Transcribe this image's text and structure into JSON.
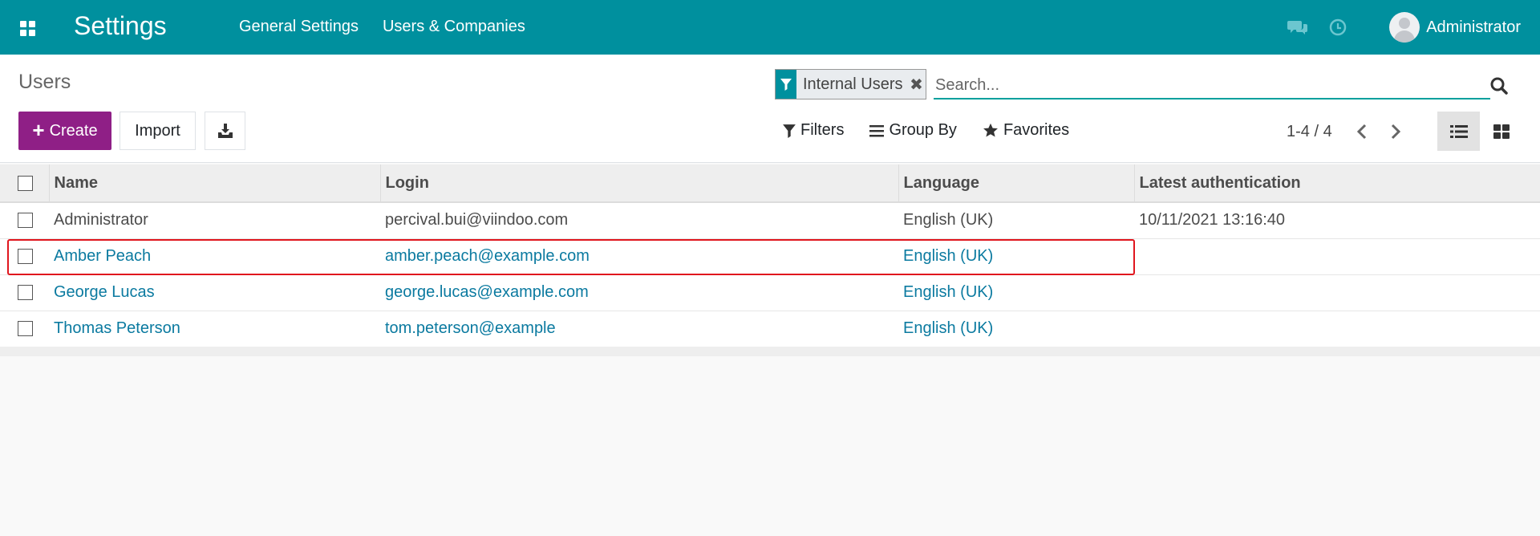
{
  "navbar": {
    "app_title": "Settings",
    "menu": [
      {
        "label": "General Settings"
      },
      {
        "label": "Users & Companies"
      }
    ],
    "user_name": "Administrator",
    "icons": [
      "apps-icon",
      "chat-icon",
      "clock-icon",
      "avatar"
    ],
    "color": "#00909e"
  },
  "control_panel": {
    "breadcrumb": "Users",
    "facet": {
      "label": "Internal Users",
      "icon": "filter-icon"
    },
    "search": {
      "placeholder": "Search..."
    },
    "buttons": {
      "create": "Create",
      "import": "Import"
    },
    "search_options": {
      "filters": "Filters",
      "group_by": "Group By",
      "favorites": "Favorites"
    },
    "pager": {
      "value": "1-4 / 4"
    },
    "create_color": "#8f1f86"
  },
  "table": {
    "columns": [
      "Name",
      "Login",
      "Language",
      "Latest authentication"
    ],
    "rows": [
      {
        "name": "Administrator",
        "login": "percival.bui@viindoo.com",
        "language": "English (UK)",
        "latest_auth": "10/11/2021 13:16:40"
      },
      {
        "name": "Amber Peach",
        "login": "amber.peach@example.com",
        "language": "English (UK)",
        "latest_auth": ""
      },
      {
        "name": "George Lucas",
        "login": "george.lucas@example.com",
        "language": "English (UK)",
        "latest_auth": ""
      },
      {
        "name": "Thomas Peterson",
        "login": "tom.peterson@example",
        "language": "English (UK)",
        "latest_auth": ""
      }
    ],
    "highlight_color": "#e0161e"
  }
}
